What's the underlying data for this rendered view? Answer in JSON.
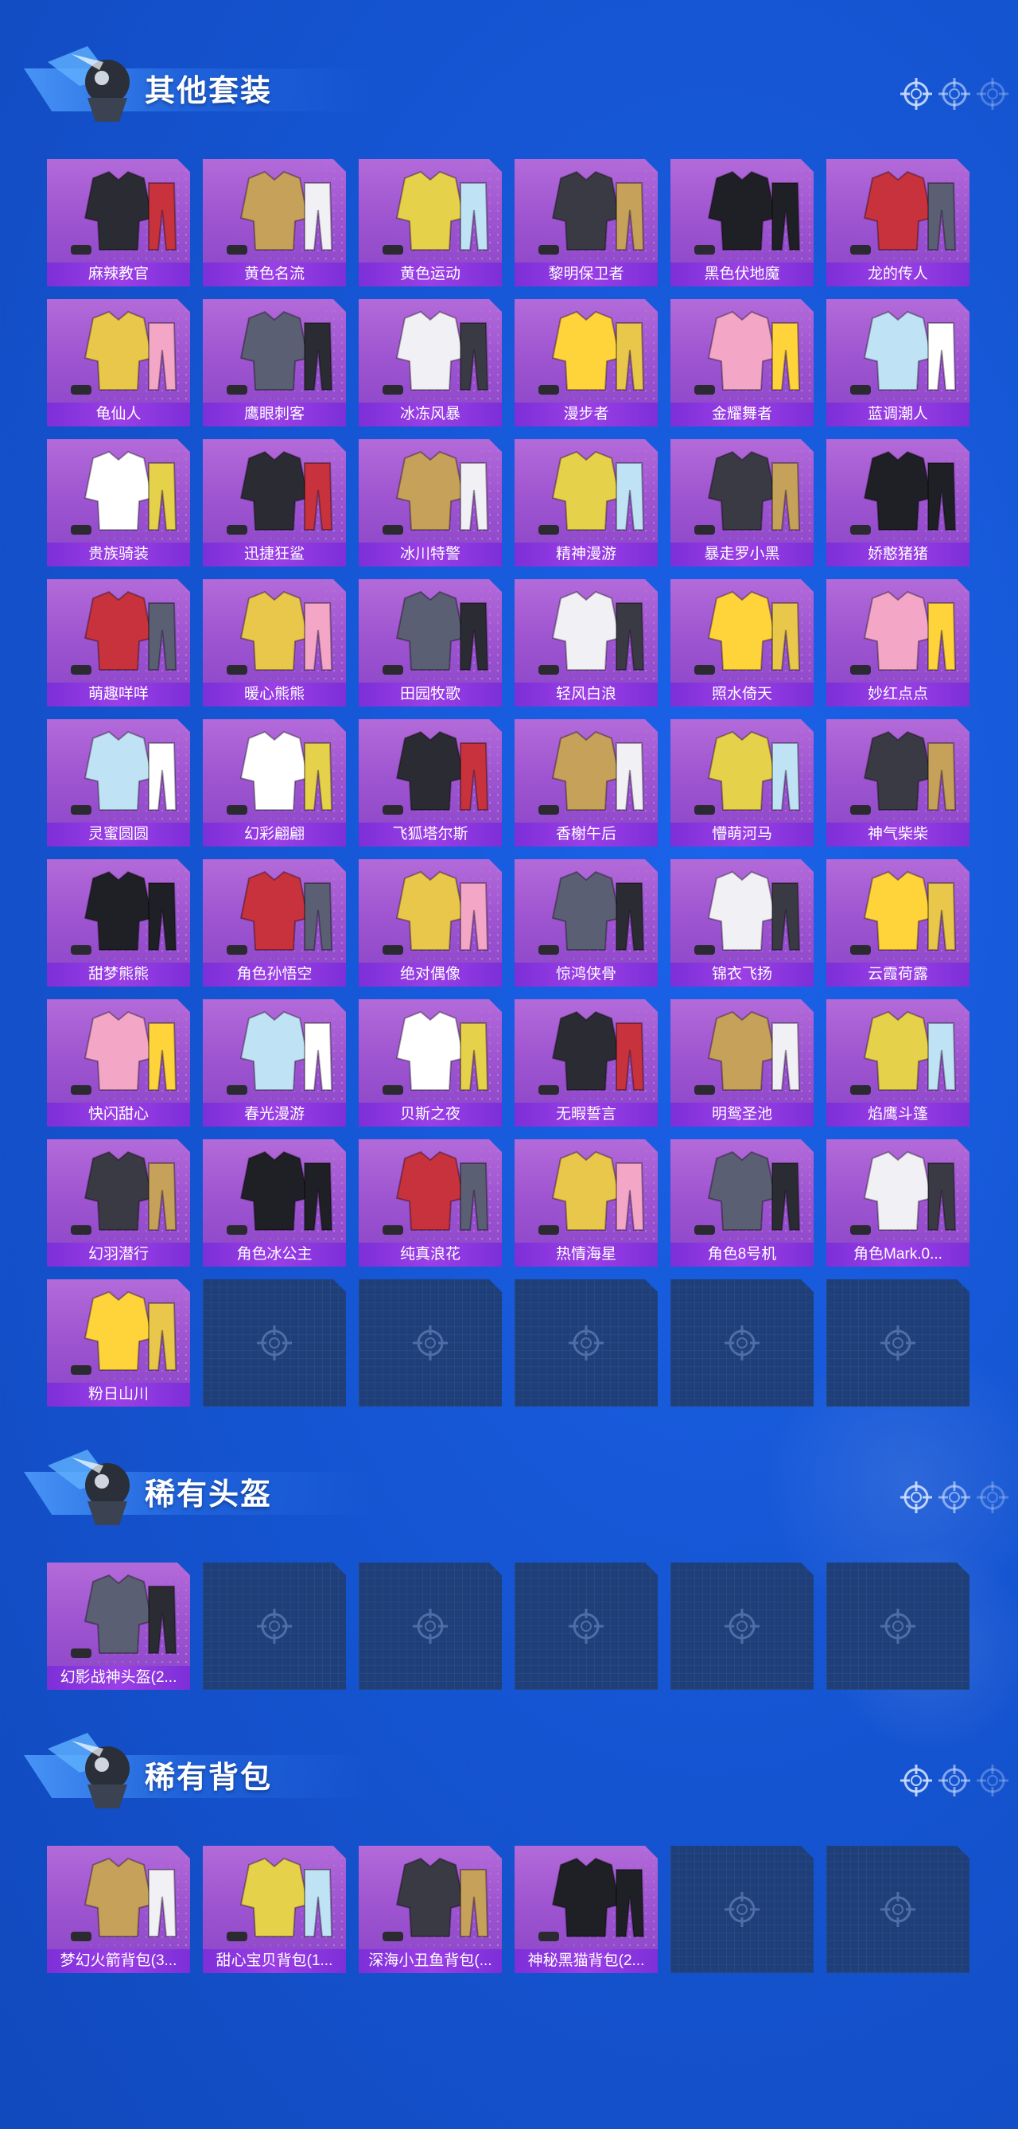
{
  "colors": {
    "background": "#1657d6",
    "card_purple": "#a45ad2",
    "label_bar": "#8a37e0",
    "empty_slot": "#1f3f7a"
  },
  "sections": [
    {
      "title": "其他套装",
      "items": [
        "麻辣教官",
        "黄色名流",
        "黄色运动",
        "黎明保卫者",
        "黑色伏地魔",
        "龙的传人",
        "龟仙人",
        "鹰眼刺客",
        "冰冻风暴",
        "漫步者",
        "金耀舞者",
        "蓝调潮人",
        "贵族骑装",
        "迅捷狂鲨",
        "冰川特警",
        "精神漫游",
        "暴走罗小黑",
        "娇憨猪猪",
        "萌趣咩咩",
        "暖心熊熊",
        "田园牧歌",
        "轻风白浪",
        "照水倚天",
        "妙红点点",
        "灵蜜圆圆",
        "幻彩翩翩",
        "飞狐塔尔斯",
        "香榭午后",
        "懵萌河马",
        "神气柴柴",
        "甜梦熊熊",
        "角色孙悟空",
        "绝对偶像",
        "惊鸿侠骨",
        "锦衣飞扬",
        "云霞荷露",
        "快闪甜心",
        "春光漫游",
        "贝斯之夜",
        "无暇誓言",
        "明鸳圣池",
        "焰鹰斗篷",
        "幻羽潜行",
        "角色冰公主",
        "纯真浪花",
        "热情海星",
        "角色8号机",
        "角色Mark.0...",
        "粉日山川"
      ],
      "empty_slots": 5
    },
    {
      "title": "稀有头盔",
      "items": [
        "幻影战神头盔(2..."
      ],
      "empty_slots": 5
    },
    {
      "title": "稀有背包",
      "items": [
        "梦幻火箭背包(3...",
        "甜心宝贝背包(1...",
        "深海小丑鱼背包(...",
        "神秘黑猫背包(2..."
      ],
      "empty_slots": 2
    }
  ]
}
